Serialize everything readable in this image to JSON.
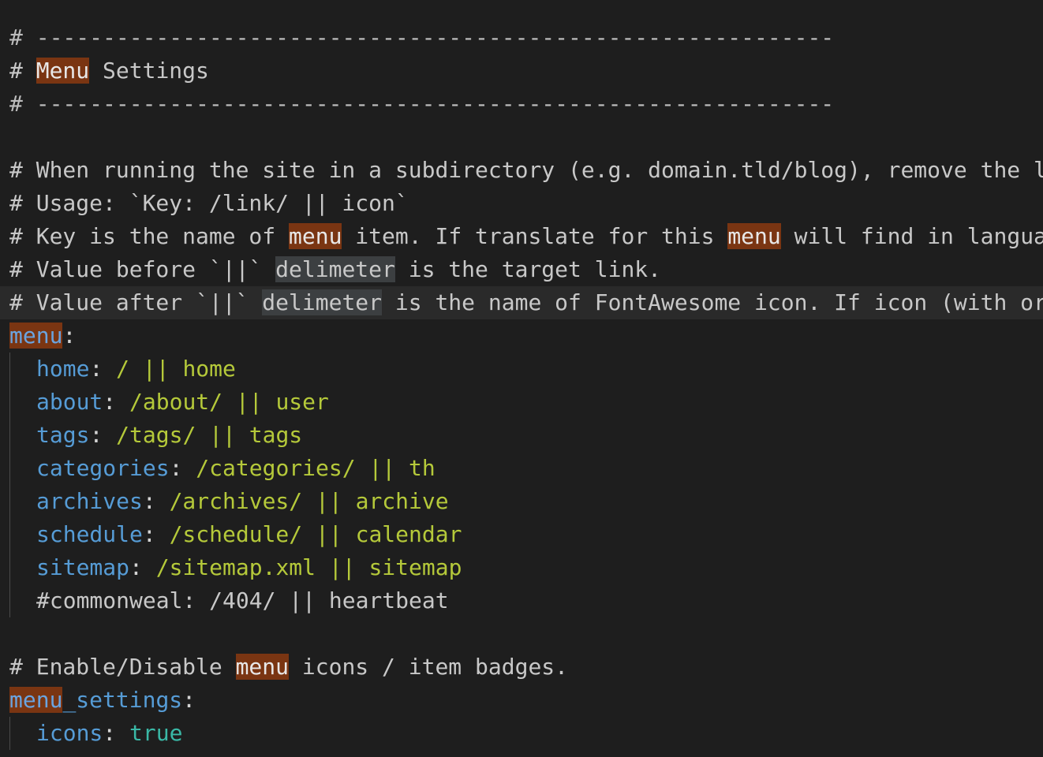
{
  "editor": {
    "banner": {
      "rule": "# ------------------------------------------------------------",
      "hash": "# ",
      "word": "Menu",
      "rest": " Settings"
    },
    "c1": "# When running the site in a subdirectory (e.g. domain.tld/blog), remove the l",
    "c2": "# Usage: `Key: /link/ || icon`",
    "c3": {
      "a": "# Key is the name of ",
      "w1": "menu",
      "b": " item. If translate for this ",
      "w2": "menu",
      "c": " will find in langua"
    },
    "c4": {
      "a": "# Value before `||` ",
      "sel": "delimeter",
      "b": " is the target link."
    },
    "c5": {
      "a": "# Value after `||` ",
      "sel": "delimeter",
      "b": " is the name of FontAwesome icon. If icon (with or"
    },
    "menu_key": "menu",
    "colon": ":",
    "items": [
      {
        "key": "home",
        "colon": ":",
        "value": " / || home"
      },
      {
        "key": "about",
        "colon": ":",
        "value": " /about/ || user"
      },
      {
        "key": "tags",
        "colon": ":",
        "value": " /tags/ || tags"
      },
      {
        "key": "categories",
        "colon": ":",
        "value": " /categories/ || th"
      },
      {
        "key": "archives",
        "colon": ":",
        "value": " /archives/ || archive"
      },
      {
        "key": "schedule",
        "colon": ":",
        "value": " /schedule/ || calendar"
      },
      {
        "key": "sitemap",
        "colon": ":",
        "value": " /sitemap.xml || sitemap"
      }
    ],
    "commented_item": "#commonweal: /404/ || heartbeat",
    "c6": {
      "a": "# Enable/Disable ",
      "w": "menu",
      "b": " icons / item badges."
    },
    "menu_settings": {
      "hl": "menu",
      "rest": "_settings"
    },
    "icons_key": "icons",
    "icons_value": "true"
  },
  "colors": {
    "background": "#1e1e1e",
    "comment": "#c8c8c8",
    "key": "#569cd6",
    "value": "#b5c93a",
    "boolean": "#3ab8a6",
    "search_highlight": "#7a3512",
    "caret": "#e08a2a"
  }
}
